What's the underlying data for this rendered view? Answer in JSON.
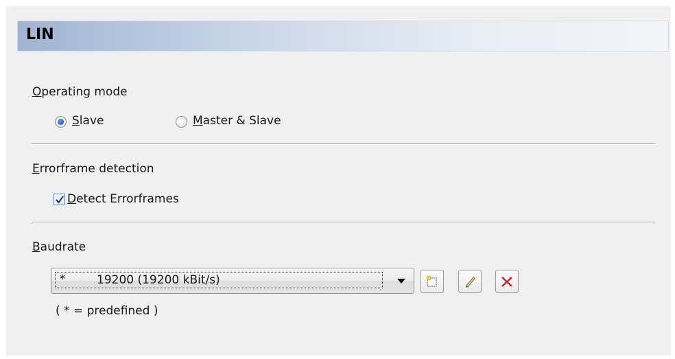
{
  "header": {
    "title": "LIN"
  },
  "operating_mode": {
    "label": "Operating mode",
    "options": [
      {
        "label": "Slave",
        "selected": true
      },
      {
        "label": "Master & Slave",
        "selected": false
      }
    ]
  },
  "errorframe": {
    "label": "Errorframe detection",
    "checkbox_label": "Detect Errorframes",
    "checked": true
  },
  "baudrate": {
    "label": "Baudrate",
    "selected_marker": "*",
    "selected_value": "19200 (19200 kBit/s)",
    "note": "( * = predefined )",
    "buttons": [
      {
        "icon": "new-icon"
      },
      {
        "icon": "edit-pencil-icon"
      },
      {
        "icon": "delete-x-icon"
      }
    ]
  },
  "colors": {
    "header_gradient_start": "#9fb4d4",
    "radio_accent": "#1c58b8",
    "delete_red": "#cc2020"
  }
}
